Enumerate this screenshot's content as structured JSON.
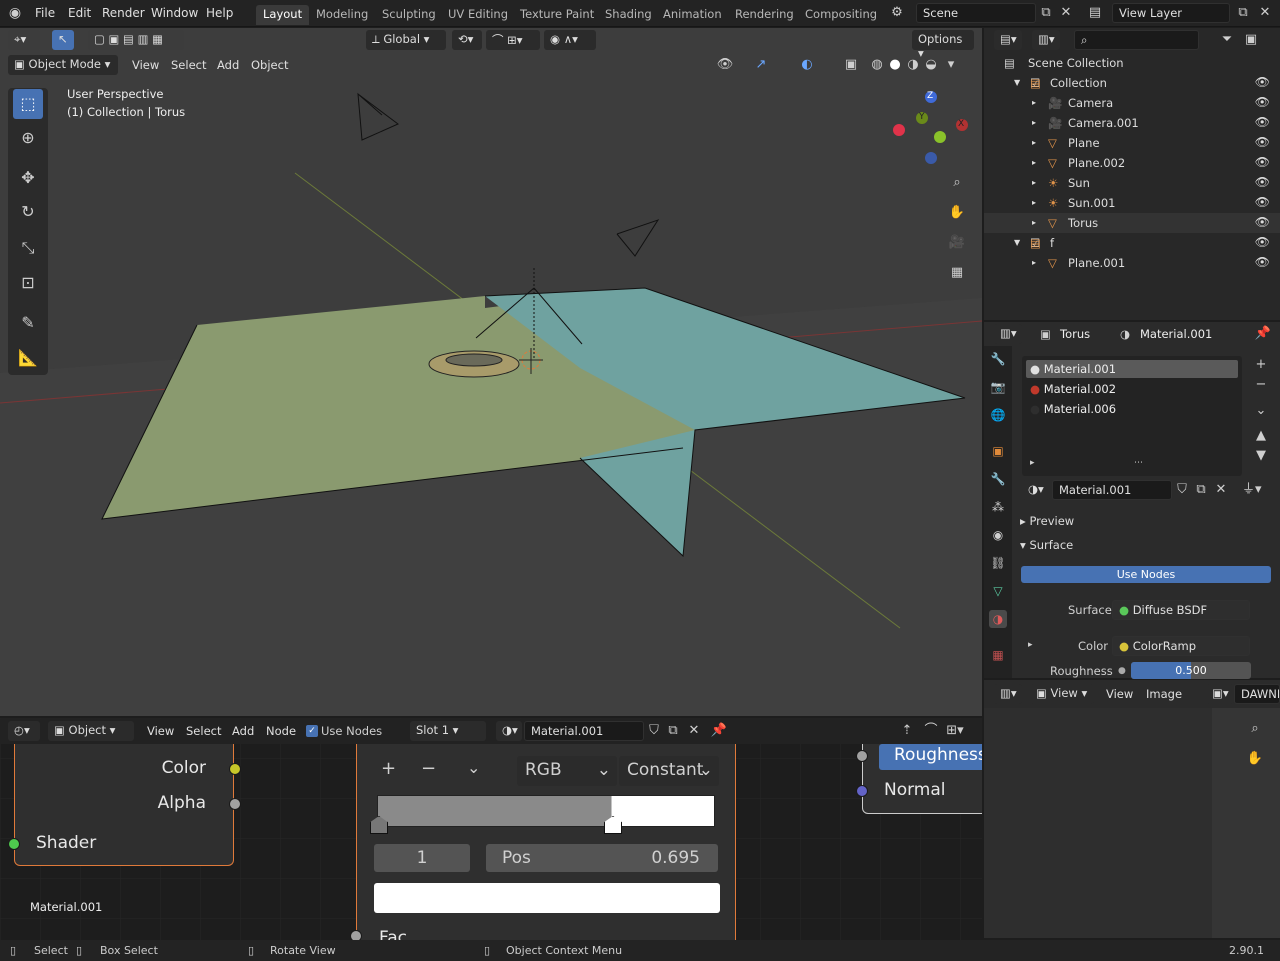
{
  "topbar": {
    "menus": [
      "File",
      "Edit",
      "Render",
      "Window",
      "Help"
    ],
    "workspaces": [
      "Layout",
      "Modeling",
      "Sculpting",
      "UV Editing",
      "Texture Paint",
      "Shading",
      "Animation",
      "Rendering",
      "Compositing"
    ],
    "scene": "Scene",
    "view_layer": "View Layer"
  },
  "viewport": {
    "orientation": "Global",
    "options": "Options",
    "mode": "Object Mode",
    "menus": [
      "View",
      "Select",
      "Add",
      "Object"
    ],
    "overlay_title": "User Perspective",
    "overlay_subtitle": "(1) Collection | Torus",
    "gizmo_axes": [
      "Z",
      "Y",
      "X"
    ]
  },
  "outliner": {
    "root": "Scene Collection",
    "rows": [
      {
        "label": "Collection",
        "indent": 1
      },
      {
        "label": "Camera",
        "indent": 2
      },
      {
        "label": "Camera.001",
        "indent": 2
      },
      {
        "label": "Plane",
        "indent": 2
      },
      {
        "label": "Plane.002",
        "indent": 2
      },
      {
        "label": "Sun",
        "indent": 2
      },
      {
        "label": "Sun.001",
        "indent": 2
      },
      {
        "label": "Torus",
        "indent": 2
      },
      {
        "label": "f",
        "indent": 1
      },
      {
        "label": "Plane.001",
        "indent": 2
      }
    ]
  },
  "properties": {
    "object": "Torus",
    "material": "Material.001",
    "slots": [
      "Material.001",
      "Material.002",
      "Material.006"
    ],
    "slot_colors": [
      "#e0e0e0",
      "#c0392b",
      "#2e2e2e"
    ],
    "material_field": "Material.001",
    "preview": "Preview",
    "surface_panel": "Surface",
    "use_nodes": "Use Nodes",
    "surface_label": "Surface",
    "surface_value": "Diffuse BSDF",
    "color_label": "Color",
    "color_value": "ColorRamp",
    "roughness_label": "Roughness",
    "roughness_value": "0.500"
  },
  "image_editor": {
    "menus": [
      "View",
      "View",
      "Image"
    ],
    "truncated": "DAWNB"
  },
  "node_editor": {
    "type": "Object",
    "menus": [
      "View",
      "Select",
      "Add",
      "Node"
    ],
    "use_nodes": "Use Nodes",
    "slot": "Slot 1",
    "material": "Material.001",
    "node1": {
      "color": "Color",
      "alpha": "Alpha",
      "shader": "Shader"
    },
    "ramp": {
      "mode": "RGB",
      "interp": "Constant",
      "index": "1",
      "pos_label": "Pos",
      "pos_value": "0.695",
      "fac": "Fac"
    },
    "node3": {
      "roughness": "Roughness",
      "normal": "Normal"
    },
    "mat_label": "Material.001"
  },
  "status": {
    "select": "Select",
    "box_select": "Box Select",
    "rotate": "Rotate View",
    "context": "Object Context Menu",
    "version": "2.90.1"
  }
}
